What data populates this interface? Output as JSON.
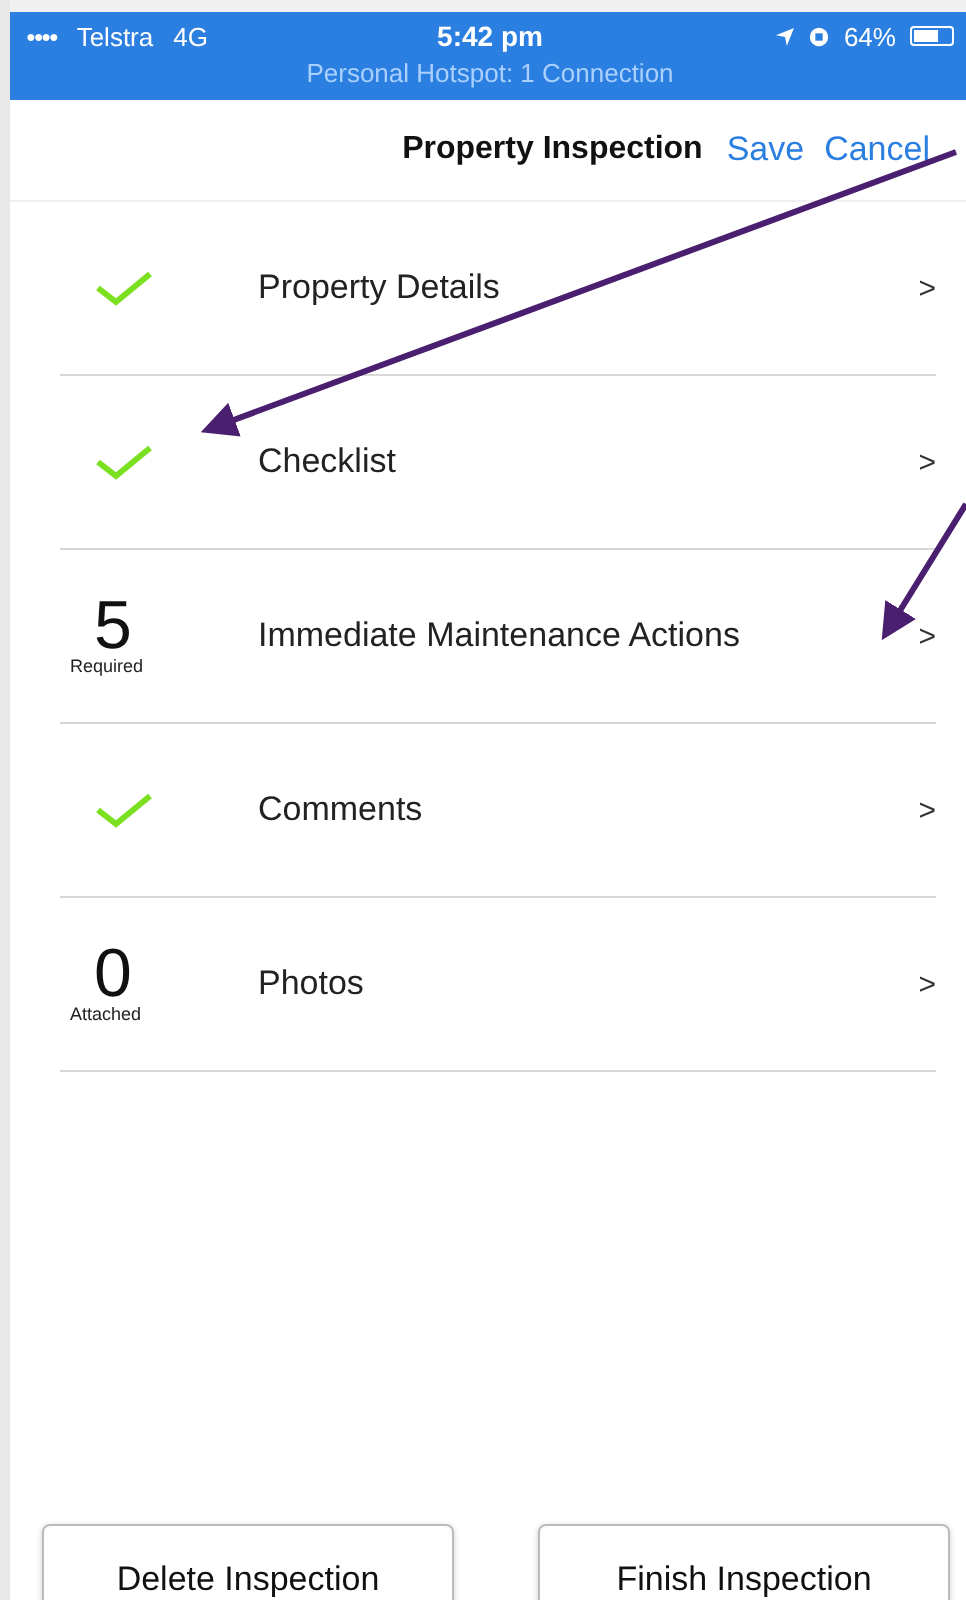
{
  "status_bar": {
    "signal": "●●●●",
    "carrier": "Telstra",
    "network": "4G",
    "time": "5:42 pm",
    "battery": "64%",
    "hotspot": "Personal Hotspot: 1 Connection"
  },
  "header": {
    "title": "Property Inspection",
    "actions": [
      "Save",
      "Cancel"
    ]
  },
  "sections": [
    {
      "kind": "check",
      "label": "Property Details",
      "chevron": ">"
    },
    {
      "kind": "check",
      "label": "Checklist",
      "chevron": ">"
    },
    {
      "kind": "count",
      "count": "5",
      "caption": "Required",
      "label": "Immediate Maintenance Actions",
      "chevron": ">"
    },
    {
      "kind": "check",
      "label": "Comments",
      "chevron": ">"
    },
    {
      "kind": "count",
      "count": "0",
      "caption": "Attached",
      "label": "Photos",
      "chevron": ">"
    }
  ],
  "buttons": [
    "Delete Inspection",
    "Finish Inspection"
  ]
}
